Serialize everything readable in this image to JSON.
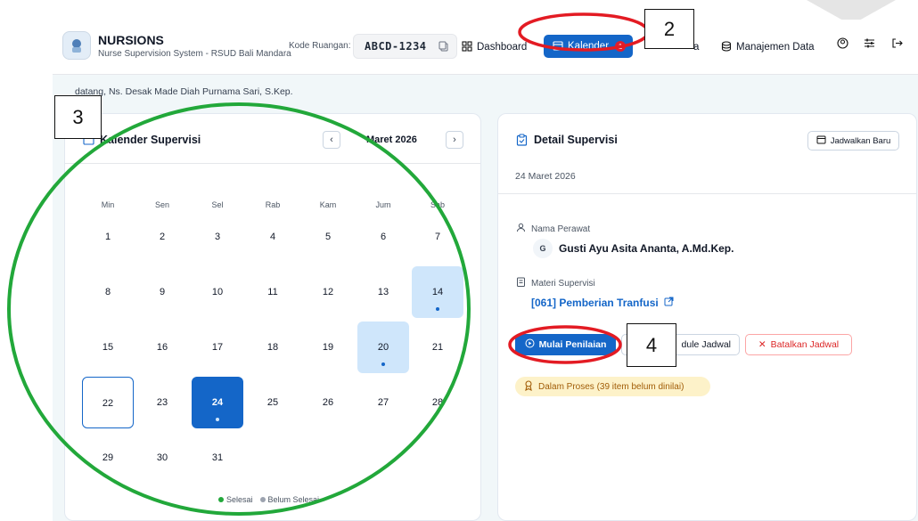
{
  "header": {
    "app_name": "NURSIONS",
    "app_subtitle": "Nurse Supervision System - RSUD Bali Mandara",
    "room_label": "Kode Ruangan:",
    "room_code": "ABCD-1234",
    "nav": {
      "dashboard": "Dashboard",
      "kalender": "Kalender",
      "kalender_badge": "1",
      "partial": "a",
      "manajemen": "Manajemen Data"
    }
  },
  "welcome_text": "datang, Ns. Desak Made Diah Purnama Sari, S.Kep.",
  "calendar": {
    "title": "Kalender Supervisi",
    "month": "Maret 2026",
    "weekdays": [
      "Min",
      "Sen",
      "Sel",
      "Rab",
      "Kam",
      "Jum",
      "Sab"
    ],
    "days": [
      "1",
      "2",
      "3",
      "4",
      "5",
      "6",
      "7",
      "8",
      "9",
      "10",
      "11",
      "12",
      "13",
      "14",
      "15",
      "16",
      "17",
      "18",
      "19",
      "20",
      "21",
      "22",
      "23",
      "24",
      "25",
      "26",
      "27",
      "28",
      "29",
      "30",
      "31"
    ],
    "highlighted_days": [
      "14",
      "20"
    ],
    "today": "22",
    "selected": "24",
    "legend_done": "Selesai",
    "legend_pending": "Belum Selesai"
  },
  "detail": {
    "title": "Detail Supervisi",
    "date": "24 Maret 2026",
    "schedule_new_label": "Jadwalkan Baru",
    "nurse_label": "Nama Perawat",
    "nurse_initial": "G",
    "nurse_name": "Gusti Ayu Asita Ananta, A.Md.Kep.",
    "materi_label": "Materi Supervisi",
    "materi_link": "[061] Pemberian Tranfusi",
    "start_button": "Mulai Penilaian",
    "reschedule_button": "dule Jadwal",
    "cancel_button": "Batalkan Jadwal",
    "status": "Dalam Proses (39 item belum dinilai)"
  },
  "callouts": {
    "c2": "2",
    "c3": "3",
    "c4": "4"
  },
  "colors": {
    "primary": "#1466c8",
    "highlight": "#cfe6fb",
    "danger": "#dc2626",
    "annotation_red": "#e31b23",
    "annotation_green": "#22a83a"
  }
}
